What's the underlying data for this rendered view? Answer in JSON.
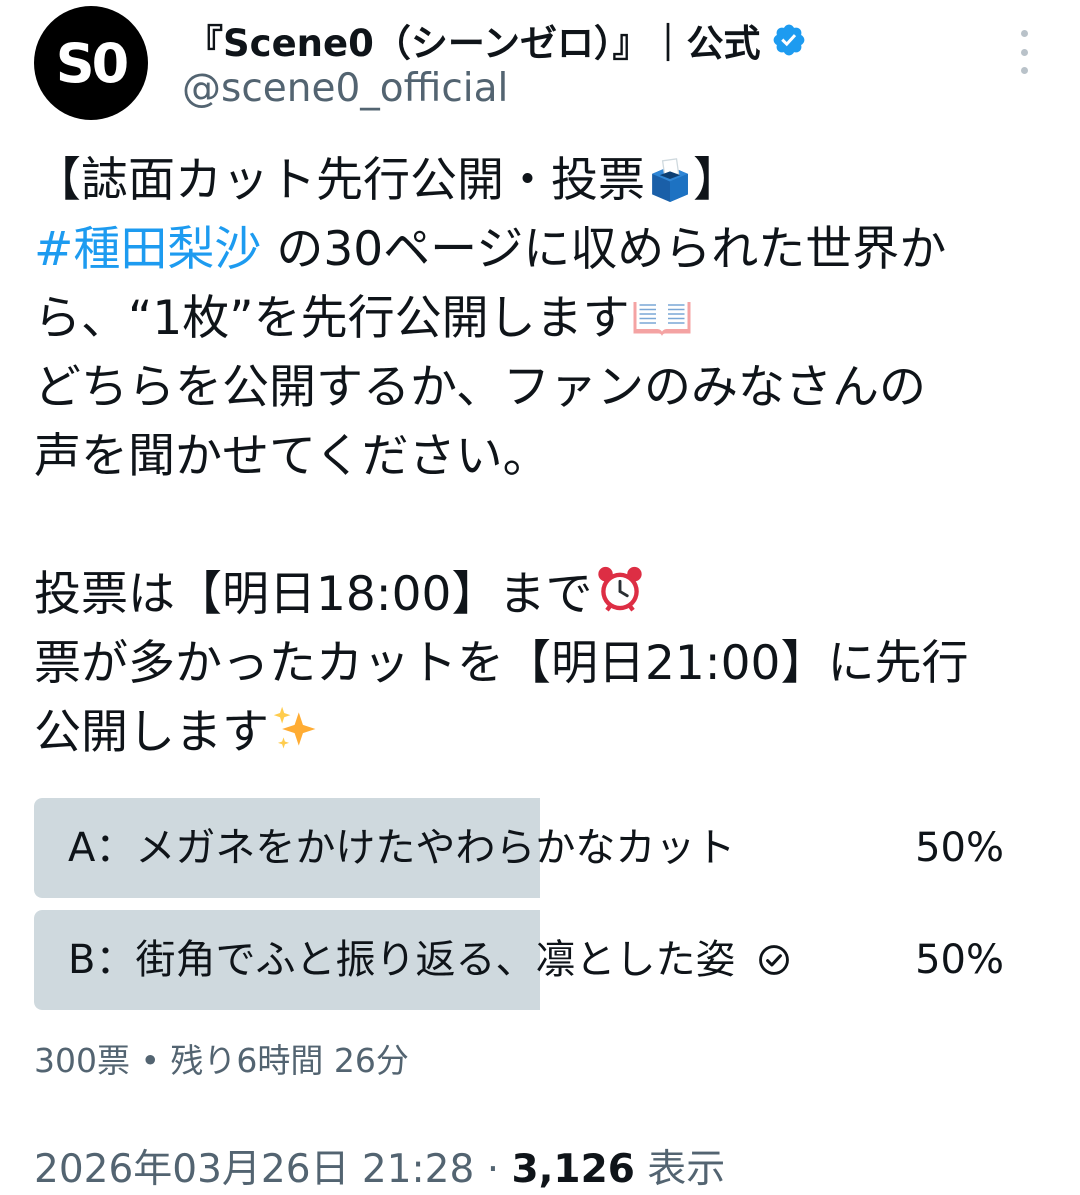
{
  "account": {
    "avatar_text": "S0",
    "display_name": "『Scene0（シーンゼロ）』｜公式",
    "handle": "@scene0_official",
    "verified_color": "#1d9bf0"
  },
  "tweet": {
    "line1_text": "【誌面カット先行公開・投票",
    "line1_end": "】",
    "line2_hashtag": "#種田梨沙",
    "line2_text": " の30ページに収められた世界か",
    "line3_text": "ら、“1枚”を先行公開します",
    "line4_text": " どちらを公開するか、ファンのみなさんの",
    "line5_text": "声を聞かせてください。",
    "line6_text": "投票は【明日18:00】まで",
    "line7_text": "票が多かったカットを【明日21:00】に先行",
    "line8_text": "公開します"
  },
  "poll": {
    "options": [
      {
        "label": "A：メガネをかけたやわらかなカット",
        "percent_text": "50%",
        "share": 0.5,
        "selected": false
      },
      {
        "label": "B：街角でふと振り返る、凛とした姿",
        "percent_text": "50%",
        "share": 0.5,
        "selected": true
      }
    ],
    "meta": "300票 • 残り6時間 26分"
  },
  "footer": {
    "timestamp": "2026年03月26日 21:28 · ",
    "views_count": "3,126",
    "views_label": " 表示"
  },
  "colors": {
    "link": "#1d9bf0",
    "poll_fill": "#cfd9de",
    "secondary_text": "#536471"
  }
}
